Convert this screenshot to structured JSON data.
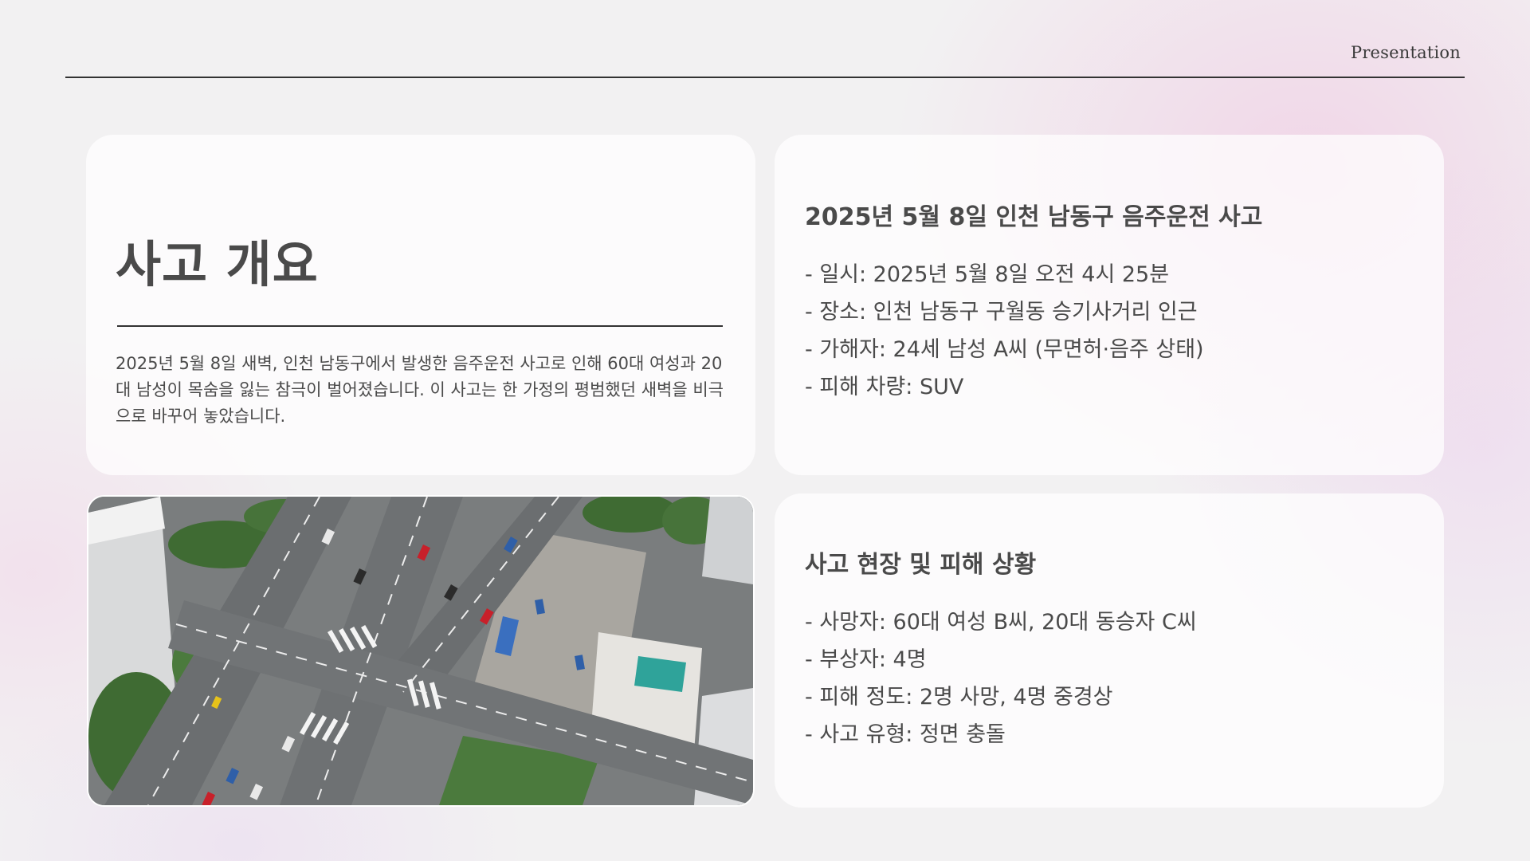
{
  "header": {
    "label": "Presentation"
  },
  "overview": {
    "title": "사고 개요",
    "description": "2025년 5월 8일 새벽, 인천 남동구에서 발생한 음주운전 사고로 인해 60대 여성과 20대 남성이 목숨을 잃는 참극이 벌어졌습니다. 이 사고는 한 가정의 평범했던 새벽을 비극으로 바꾸어 놓았습니다."
  },
  "accident_info": {
    "heading": "2025년 5월 8일 인천 남동구 음주운전 사고",
    "items": [
      "- 일시: 2025년 5월 8일 오전 4시 25분",
      "- 장소: 인천 남동구 구월동 승기사거리 인근",
      "- 가해자: 24세 남성 A씨 (무면허·음주 상태)",
      "- 피해 차량: SUV"
    ]
  },
  "damage_info": {
    "heading": "사고 현장 및 피해 상황",
    "items": [
      "- 사망자: 60대 여성 B씨, 20대 동승자 C씨",
      "- 부상자: 4명",
      "- 피해 정도: 2명 사망, 4명 중경상",
      "- 사고 유형: 정면 충돌"
    ]
  },
  "photo": {
    "icon": "aerial-intersection-photo"
  }
}
